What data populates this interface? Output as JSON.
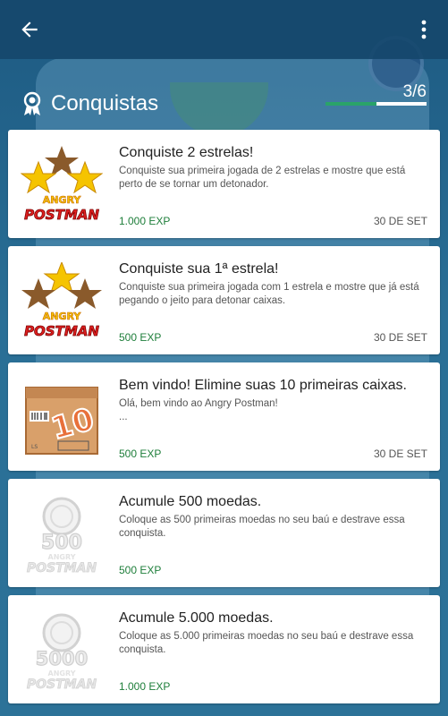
{
  "header": {
    "title": "Conquistas",
    "progress_text": "3/6",
    "progress_fraction": 0.5,
    "accent_color": "#2aa36a"
  },
  "achievements": [
    {
      "title": "Conquiste 2 estrelas!",
      "description": "Conquiste sua primeira jogada de 2 estrelas e mostre que está perto de se tornar um detonador.",
      "exp": "1.000 EXP",
      "date": "30 DE SET",
      "icon": "two-stars-angry-postman-badge",
      "badge_text": "ANGRY POSTMAN",
      "unlocked": true
    },
    {
      "title": "Conquiste sua 1ª estrela!",
      "description": "Conquiste sua primeira jogada com 1 estrela e mostre que já está pegando o jeito para detonar caixas.",
      "exp": "500 EXP",
      "date": "30 DE SET",
      "icon": "one-star-angry-postman-badge",
      "badge_text": "ANGRY POSTMAN",
      "unlocked": true
    },
    {
      "title": "Bem vindo! Elimine suas 10 primeiras caixas.",
      "description": "Olá, bem vindo ao Angry Postman!\n...",
      "exp": "500 EXP",
      "date": "30 DE SET",
      "icon": "box-10-badge",
      "badge_text": "10",
      "unlocked": true
    },
    {
      "title": "Acumule 500 moedas.",
      "description": "Coloque as 500 primeiras moedas no seu baú e destrave essa conquista.",
      "exp": "500 EXP",
      "date": "",
      "icon": "coins-500-badge-locked",
      "badge_text": "500",
      "badge_brand": "ANGRY POSTMAN",
      "unlocked": false
    },
    {
      "title": "Acumule 5.000 moedas.",
      "description": "Coloque as 5.000 primeiras moedas no seu baú e destrave essa conquista.",
      "exp": "1.000 EXP",
      "date": "",
      "icon": "coins-5000-badge-locked",
      "badge_text": "5000",
      "badge_brand": "ANGRY POSTMAN",
      "unlocked": false
    }
  ]
}
